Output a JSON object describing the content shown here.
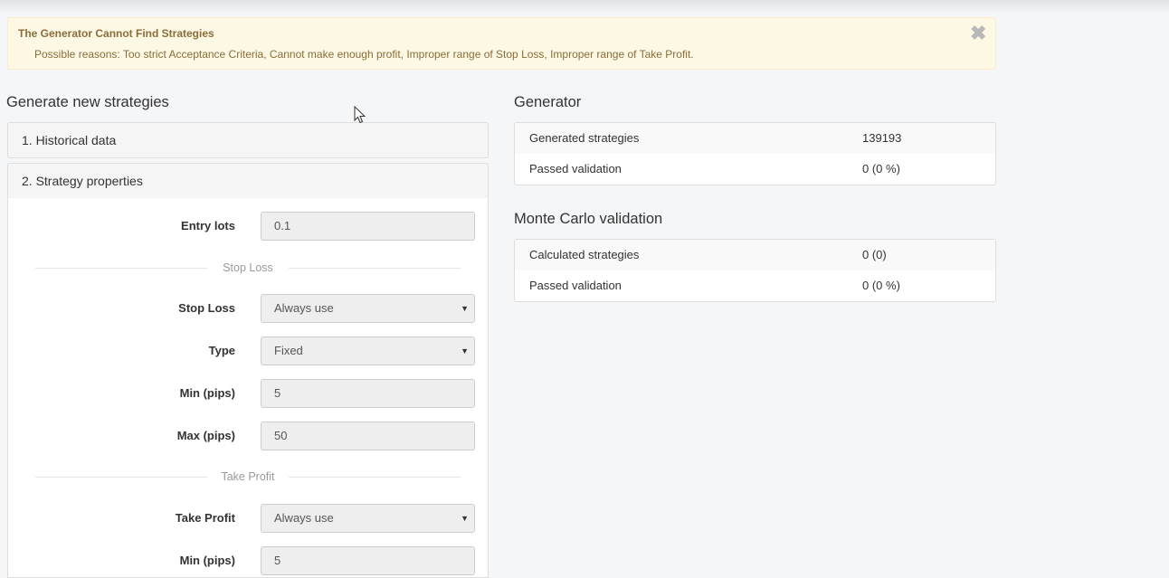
{
  "alert": {
    "title": "The Generator Cannot Find Strategies",
    "text": "Possible reasons: Too strict Acceptance Criteria, Cannot make enough profit, Improper range of Stop Loss, Improper range of Take Profit.",
    "close_glyph": "✖"
  },
  "left": {
    "title": "Generate new strategies",
    "panels": [
      {
        "label": "1. Historical data"
      },
      {
        "label": "2. Strategy properties"
      }
    ],
    "form": {
      "entry_lots": {
        "label": "Entry lots",
        "value": "0.1"
      },
      "stop_loss_divider": "Stop Loss",
      "stop_loss": {
        "label": "Stop Loss",
        "value": "Always use"
      },
      "sl_type": {
        "label": "Type",
        "value": "Fixed"
      },
      "sl_min": {
        "label": "Min (pips)",
        "value": "5"
      },
      "sl_max": {
        "label": "Max (pips)",
        "value": "50"
      },
      "take_profit_divider": "Take Profit",
      "take_profit": {
        "label": "Take Profit",
        "value": "Always use"
      },
      "tp_min": {
        "label": "Min (pips)",
        "value": "5"
      }
    },
    "caret": "▼"
  },
  "generator": {
    "title": "Generator",
    "rows": [
      {
        "key": "Generated strategies",
        "value": "139193"
      },
      {
        "key": "Passed validation",
        "value": "0 (0 %)"
      }
    ]
  },
  "monte_carlo": {
    "title": "Monte Carlo validation",
    "rows": [
      {
        "key": "Calculated strategies",
        "value": "0 (0)"
      },
      {
        "key": "Passed validation",
        "value": "0 (0 %)"
      }
    ]
  },
  "colors": {
    "alert_bg": "#fcf8e3",
    "alert_text": "#8a6d3b",
    "page_bg": "#f4f6f8",
    "panel_border": "#dddddd"
  }
}
